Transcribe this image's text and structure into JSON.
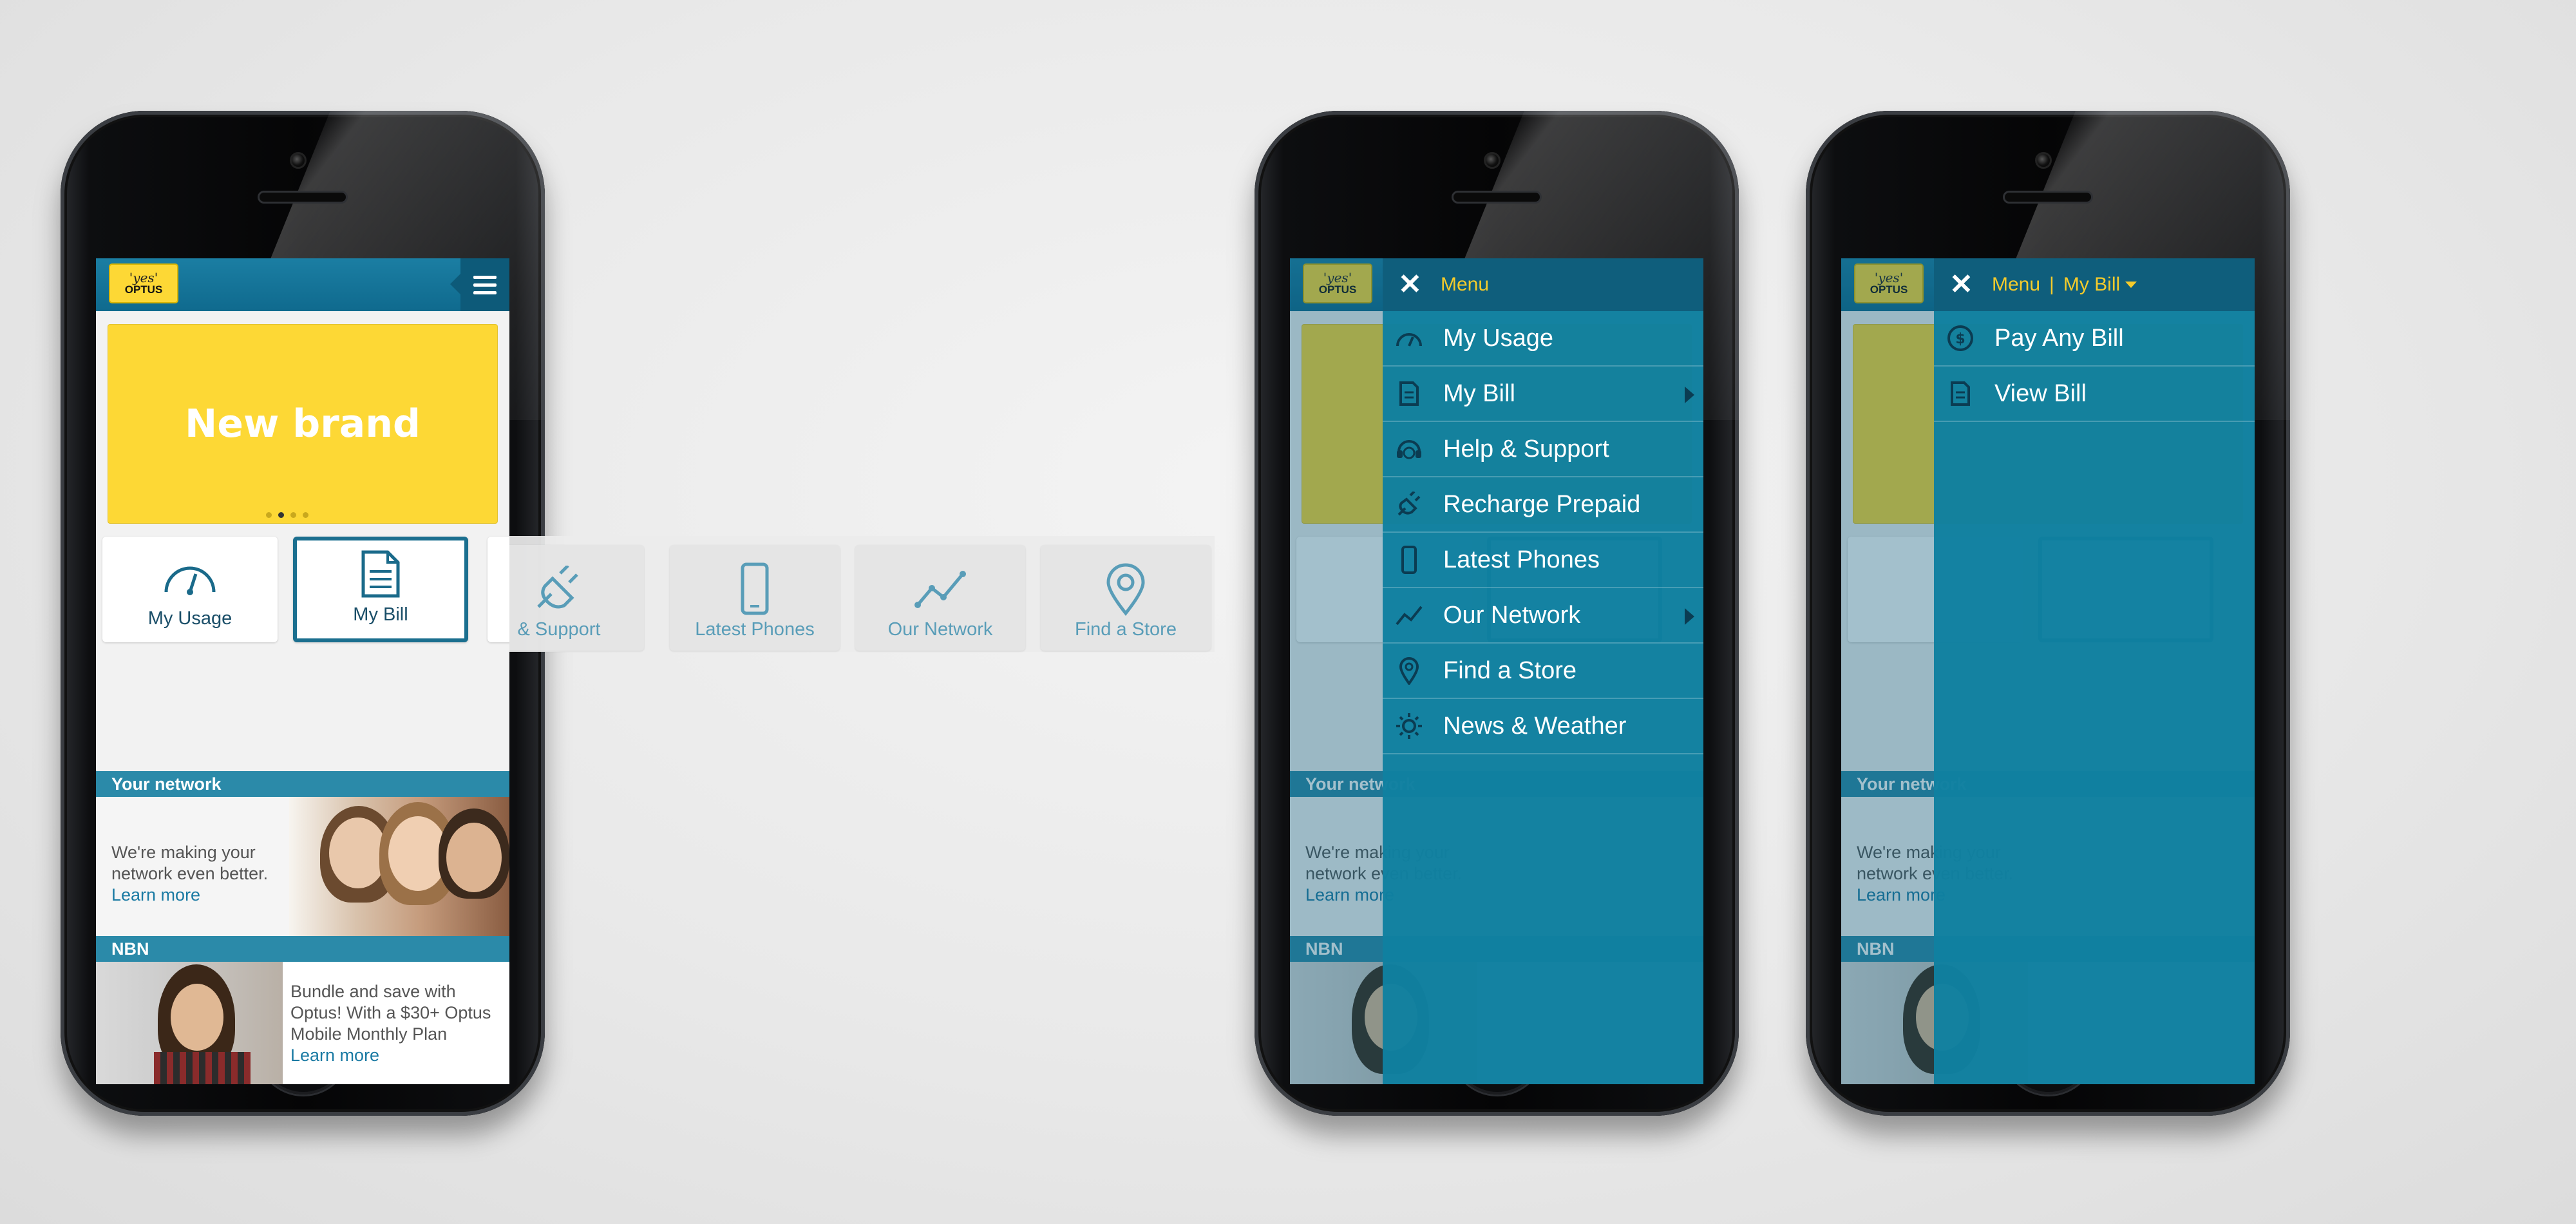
{
  "brand": {
    "logo_yes": "'yes'",
    "logo_optus": "OPTUS"
  },
  "banner": {
    "text": "New brand",
    "slide_count": 4,
    "active_slide": 2
  },
  "tiles": [
    {
      "label": "My Usage",
      "icon": "gauge-icon"
    },
    {
      "label": "My Bill",
      "icon": "document-icon"
    },
    {
      "label": "Help & Support",
      "icon": "plug-icon"
    },
    {
      "label": "Latest Phones",
      "icon": "phone-icon"
    },
    {
      "label": "Our Network",
      "icon": "network-graph-icon"
    },
    {
      "label": "Find a Store",
      "icon": "location-pin-icon"
    }
  ],
  "strip_tiles": [
    {
      "label": "& Support"
    },
    {
      "label": "Latest Phones"
    },
    {
      "label": "Our Network"
    },
    {
      "label": "Find a Store"
    }
  ],
  "sections": {
    "network": {
      "heading": "Your network",
      "line1": "We're making your",
      "line2": "network even better.",
      "link": "Learn more"
    },
    "nbn": {
      "heading": "NBN",
      "line1": "Bundle and save with",
      "line2": "Optus! With a $30+ Optus",
      "line3": "Mobile Monthly Plan",
      "link": "Learn more"
    }
  },
  "menu": {
    "title": "Menu",
    "items": [
      {
        "label": "My Usage",
        "icon": "gauge-icon",
        "has_submenu": false
      },
      {
        "label": "My Bill",
        "icon": "document-icon",
        "has_submenu": true
      },
      {
        "label": "Help & Support",
        "icon": "headset-icon",
        "has_submenu": false
      },
      {
        "label": "Recharge Prepaid",
        "icon": "plug-icon",
        "has_submenu": false
      },
      {
        "label": "Latest Phones",
        "icon": "phone-icon",
        "has_submenu": false
      },
      {
        "label": "Our Network",
        "icon": "network-graph-icon",
        "has_submenu": true
      },
      {
        "label": "Find a Store",
        "icon": "location-pin-icon",
        "has_submenu": false
      },
      {
        "label": "News & Weather",
        "icon": "sun-icon",
        "has_submenu": false
      }
    ]
  },
  "submenu": {
    "title": "Menu",
    "separator": "|",
    "current": "My Bill",
    "items": [
      {
        "label": "Pay Any Bill",
        "icon": "dollar-coin-icon"
      },
      {
        "label": "View Bill",
        "icon": "document-icon"
      }
    ]
  },
  "colors": {
    "brand_yellow": "#fdd835",
    "brand_teal": "#1b7ea3",
    "menu_teal": "#0f80a0",
    "accent_yellow": "#f5cb2b"
  }
}
